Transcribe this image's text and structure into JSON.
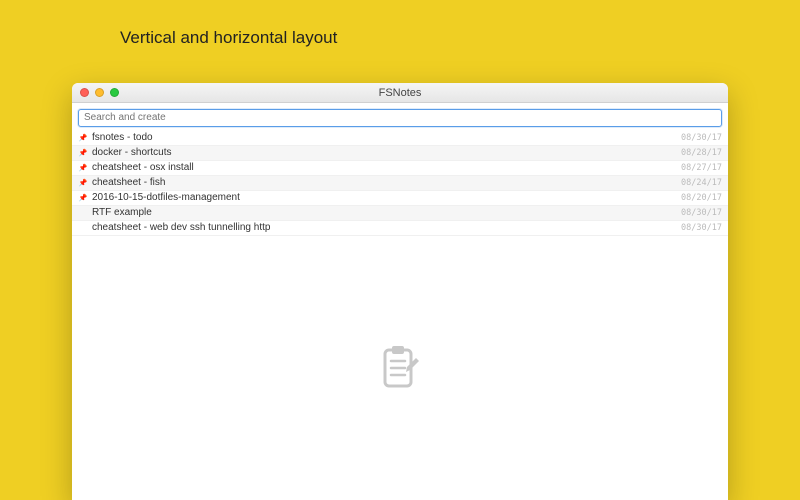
{
  "page": {
    "heading": "Vertical and horizontal layout"
  },
  "window": {
    "title": "FSNotes"
  },
  "search": {
    "placeholder": "Search and create"
  },
  "notes": [
    {
      "pinned": true,
      "title": "fsnotes - todo",
      "date": "08/30/17"
    },
    {
      "pinned": true,
      "title": "docker - shortcuts",
      "date": "08/28/17"
    },
    {
      "pinned": true,
      "title": "cheatsheet - osx install",
      "date": "08/27/17"
    },
    {
      "pinned": true,
      "title": "cheatsheet - fish",
      "date": "08/24/17"
    },
    {
      "pinned": true,
      "title": "2016-10-15-dotfiles-management",
      "date": "08/20/17"
    },
    {
      "pinned": false,
      "title": "RTF example",
      "date": "08/30/17"
    },
    {
      "pinned": false,
      "title": "cheatsheet - web dev ssh tunnelling http",
      "date": "08/30/17"
    }
  ],
  "icons": {
    "pin_glyph": "📌"
  }
}
